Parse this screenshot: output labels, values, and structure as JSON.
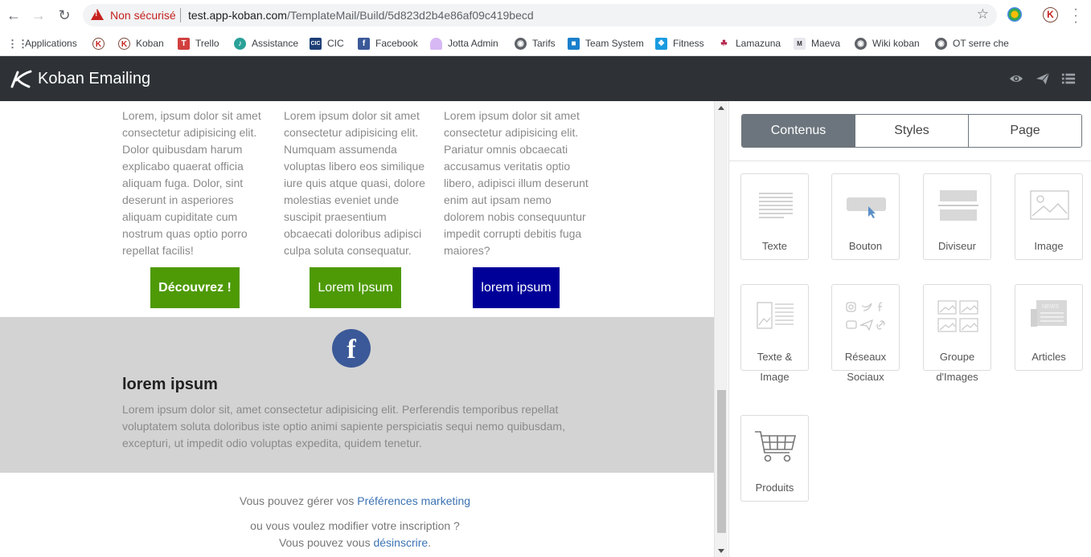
{
  "browser": {
    "not_secure": "Non sécurisé",
    "url_host": "test.app-koban.com",
    "url_path": "/TemplateMail/Build/5d823d2b4e86af09c419becd",
    "bookmarks": [
      "Applications",
      "Koban",
      "Trello",
      "Assistance",
      "CIC",
      "Facebook",
      "Jotta Admin",
      "Tarifs",
      "Team System",
      "Fitness",
      "Lamazuna",
      "Maeva",
      "Wiki koban",
      "OT serre che"
    ]
  },
  "app": {
    "title": "Koban Emailing"
  },
  "email": {
    "columns": [
      {
        "text": "Lorem, ipsum dolor sit amet consectetur adipisicing elit. Dolor quibusdam harum explicabo quaerat officia aliquam fuga. Dolor, sint deserunt in asperiores aliquam cupiditate cum nostrum quas optio porro repellat facilis!",
        "button": "Découvrez !"
      },
      {
        "text": "Lorem ipsum dolor sit amet consectetur adipisicing elit. Numquam assumenda voluptas libero eos similique iure quis atque quasi, dolore molestias eveniet unde suscipit praesentium obcaecati doloribus adipisci culpa soluta consequatur.",
        "button": "Lorem Ipsum"
      },
      {
        "text": "Lorem ipsum dolor sit amet consectetur adipisicing elit. Pariatur omnis obcaecati accusamus veritatis optio libero, adipisci illum deserunt enim aut ipsam nemo dolorem nobis consequuntur impedit corrupti debitis fuga maiores?",
        "button": "lorem ipsum"
      }
    ],
    "button_colors": [
      "#4e9a06",
      "#4e9a06",
      "#000099"
    ],
    "social_block": {
      "title": "lorem ipsum",
      "text": "Lorem ipsum dolor sit, amet consectetur adipisicing elit. Perferendis temporibus repellat voluptatem soluta doloribus iste optio animi sapiente perspiciatis sequi nemo quibusdam, excepturi, ut impedit odio voluptas expedita, quidem tenetur."
    },
    "legal": {
      "line1_prefix": "Vous pouvez gérer vos ",
      "line1_link": "Préférences marketing",
      "line2": "ou vous voulez modifier votre inscription ?",
      "line3_prefix": "Vous pouvez vous ",
      "line3_link": "désinscrire",
      "line3_suffix": "."
    }
  },
  "panel": {
    "tabs": [
      "Contenus",
      "Styles",
      "Page"
    ],
    "active_tab": "Contenus",
    "blocks": [
      {
        "label1": "Texte",
        "label2": "",
        "icon": "text-block-icon"
      },
      {
        "label1": "Bouton",
        "label2": "",
        "icon": "button-block-icon"
      },
      {
        "label1": "Diviseur",
        "label2": "",
        "icon": "divider-block-icon"
      },
      {
        "label1": "Image",
        "label2": "",
        "icon": "image-block-icon"
      },
      {
        "label1": "Texte &",
        "label2": "Image",
        "icon": "text-image-block-icon"
      },
      {
        "label1": "Réseaux",
        "label2": "Sociaux",
        "icon": "social-block-icon"
      },
      {
        "label1": "Groupe",
        "label2": "d'Images",
        "icon": "image-group-block-icon"
      },
      {
        "label1": "Articles",
        "label2": "",
        "icon": "articles-block-icon"
      },
      {
        "label1": "Produits",
        "label2": "",
        "icon": "products-block-icon"
      }
    ]
  }
}
